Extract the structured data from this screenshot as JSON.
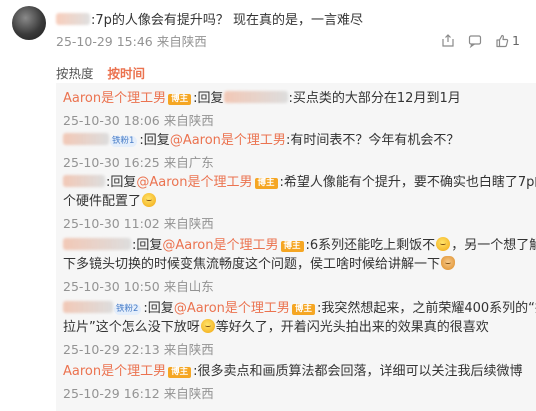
{
  "top_comment": {
    "text": ":7p的人像会有提升吗？ 现在真的是，一言难尽",
    "time": "25-10-29 15:46",
    "source": "来自陕西",
    "like_count": "1"
  },
  "sort": {
    "by_heat": "按热度",
    "by_time": "按时间",
    "active": "按时间"
  },
  "replies": [
    {
      "user": "Aaron是个理工男",
      "badge": "博主",
      "parts": [
        ":回复",
        ":买点类的大部分在12月到1月"
      ],
      "time": "25-10-30 18:06",
      "source": "来自陕西"
    },
    {
      "badge": "铁粉1",
      "prefix": ":回复",
      "mention": "@Aaron是个理工男",
      "text": ":有时间表不？今年有机会不？",
      "time": "25-10-30 16:25",
      "source": "来自广东"
    },
    {
      "prefix": ":回复",
      "mention": "@Aaron是个理工男",
      "badge": "博主",
      "text_line1": ":希望人像能有个提升，要不确实也白瞎了7p的这",
      "text_line2": "个硬件配置了",
      "time": "25-10-30 11:02",
      "source": "来自陕西"
    },
    {
      "prefix": ":回复",
      "mention": "@Aaron是个理工男",
      "badge": "博主",
      "text_line1a": ":6系列还能吃上剩饭不",
      "text_line1b": "，另一个想了解一",
      "text_line2": "下多镜头切换的时候变焦流畅度这个问题，侯工啥时候给讲解一下",
      "time": "25-10-30 10:50",
      "source": "来自山东"
    },
    {
      "badge": "铁粉2",
      "prefix": ":回复",
      "mention": "@Aaron是个理工男",
      "badge2": "博主",
      "text_line1": ":我突然想起来，之前荣耀400系列的“撕",
      "text_line2a": "拉片”这个怎么没下放呀",
      "text_line2b": "等好久了，开着闪光头拍出来的效果真的很喜欢",
      "time": "25-10-29 22:13",
      "source": "来自陕西"
    },
    {
      "user": "Aaron是个理工男",
      "badge": "博主",
      "text": ":很多卖点和画质算法都会回落，详细可以关注我后续微博",
      "time": "25-10-29 16:12",
      "source": "来自陕西"
    }
  ],
  "icons": [
    "share-icon",
    "comment-icon",
    "like-icon",
    "laugh-emoji",
    "shy-emoji",
    "cry-emoji",
    "dog-emoji"
  ],
  "colors": {
    "accent": "#eb7350",
    "meta": "#939393",
    "panel_bg": "#f6f6f6",
    "badge_author": "#f5a623",
    "badge_fan": "#4a7ec7"
  }
}
